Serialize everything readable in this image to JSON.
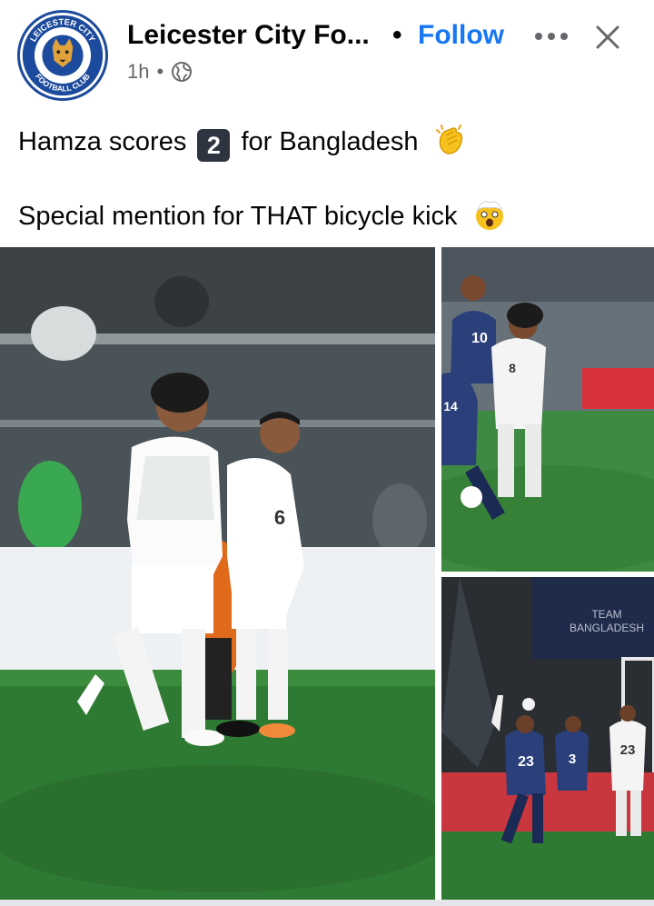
{
  "post": {
    "author": "Leicester City Fo...",
    "separator": "•",
    "follow_label": "Follow",
    "time": "1h",
    "time_sep": "•",
    "audience_icon": "globe-icon",
    "line1_before": "Hamza scores",
    "keycap": "2",
    "line1_after": "for Bangladesh",
    "line1_emoji": "clapping-hands-emoji",
    "line2": "Special mention for THAT bicycle kick",
    "line2_emoji": "shocked-face-emoji"
  },
  "avatar": {
    "ring_top": "LEICESTER CITY",
    "ring_bottom": "FOOTBALL CLUB"
  },
  "photos": {
    "photo1": {
      "shirt_number": "6"
    },
    "photo2": {
      "shirt_numbers": [
        "10",
        "8",
        "14"
      ]
    },
    "photo3": {
      "banner": [
        "TEAM",
        "BANGLADESH"
      ],
      "shirt_numbers": [
        "23",
        "3",
        "23"
      ]
    }
  },
  "colors": {
    "follow": "#1877f2",
    "brand_blue": "#1c4a9c",
    "secondary_text": "#65676b"
  }
}
